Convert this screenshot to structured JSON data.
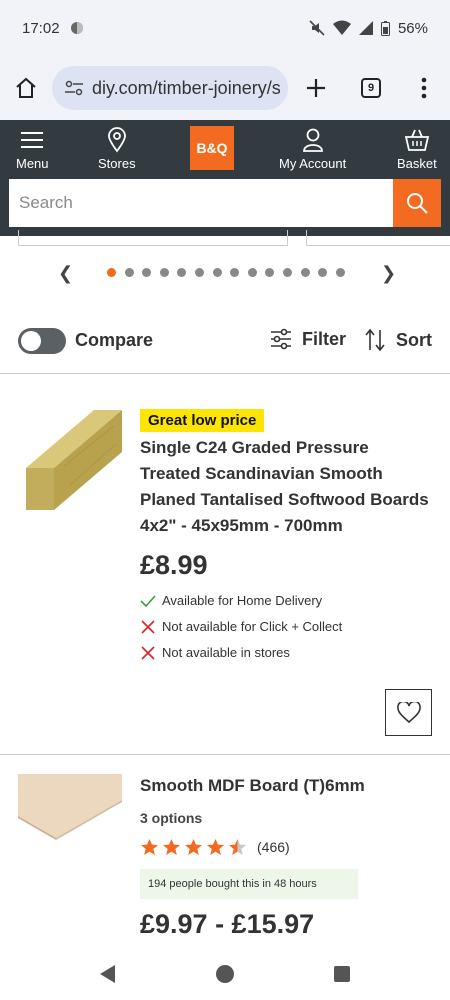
{
  "status_bar": {
    "time": "17:02",
    "battery": "56%"
  },
  "browser": {
    "url": "diy.com/timber-joinery/s",
    "tab_count": "9"
  },
  "site_nav": {
    "logo": "B&Q",
    "items": [
      {
        "label": "Menu",
        "icon": "hamburger-icon"
      },
      {
        "label": "Stores",
        "icon": "location-pin-icon"
      },
      {
        "label": "My Account",
        "icon": "person-icon"
      },
      {
        "label": "Basket",
        "icon": "basket-icon"
      }
    ],
    "search_placeholder": "Search"
  },
  "carousel": {
    "dot_count": 14,
    "active_index": 0
  },
  "toolbar": {
    "compare_label": "Compare",
    "compare_on": false,
    "filter_label": "Filter",
    "sort_label": "Sort"
  },
  "products": [
    {
      "badge": "Great low price",
      "title_lines": [
        "Single C24 Graded Pressure",
        "Treated Scandinavian Smooth",
        "Planed Tantalised Softwood Boards",
        "4x2\" - 45x95mm - 700mm"
      ],
      "price": "£8.99",
      "availability": [
        {
          "text": "Available for Home Delivery",
          "available": true
        },
        {
          "text": "Not available for Click + Collect",
          "available": false
        },
        {
          "text": "Not available in stores",
          "available": false
        }
      ]
    },
    {
      "title": "Smooth MDF Board (T)6mm",
      "options": "3 options",
      "rating": 4.5,
      "review_count": "(466)",
      "bought_note": "194 people bought this in 48 hours",
      "price": "£9.97 - £15.97"
    }
  ],
  "colors": {
    "brand_orange": "#f26b21",
    "header_dark": "#333b40",
    "badge_yellow": "#fce505",
    "star": "#f26b21"
  }
}
